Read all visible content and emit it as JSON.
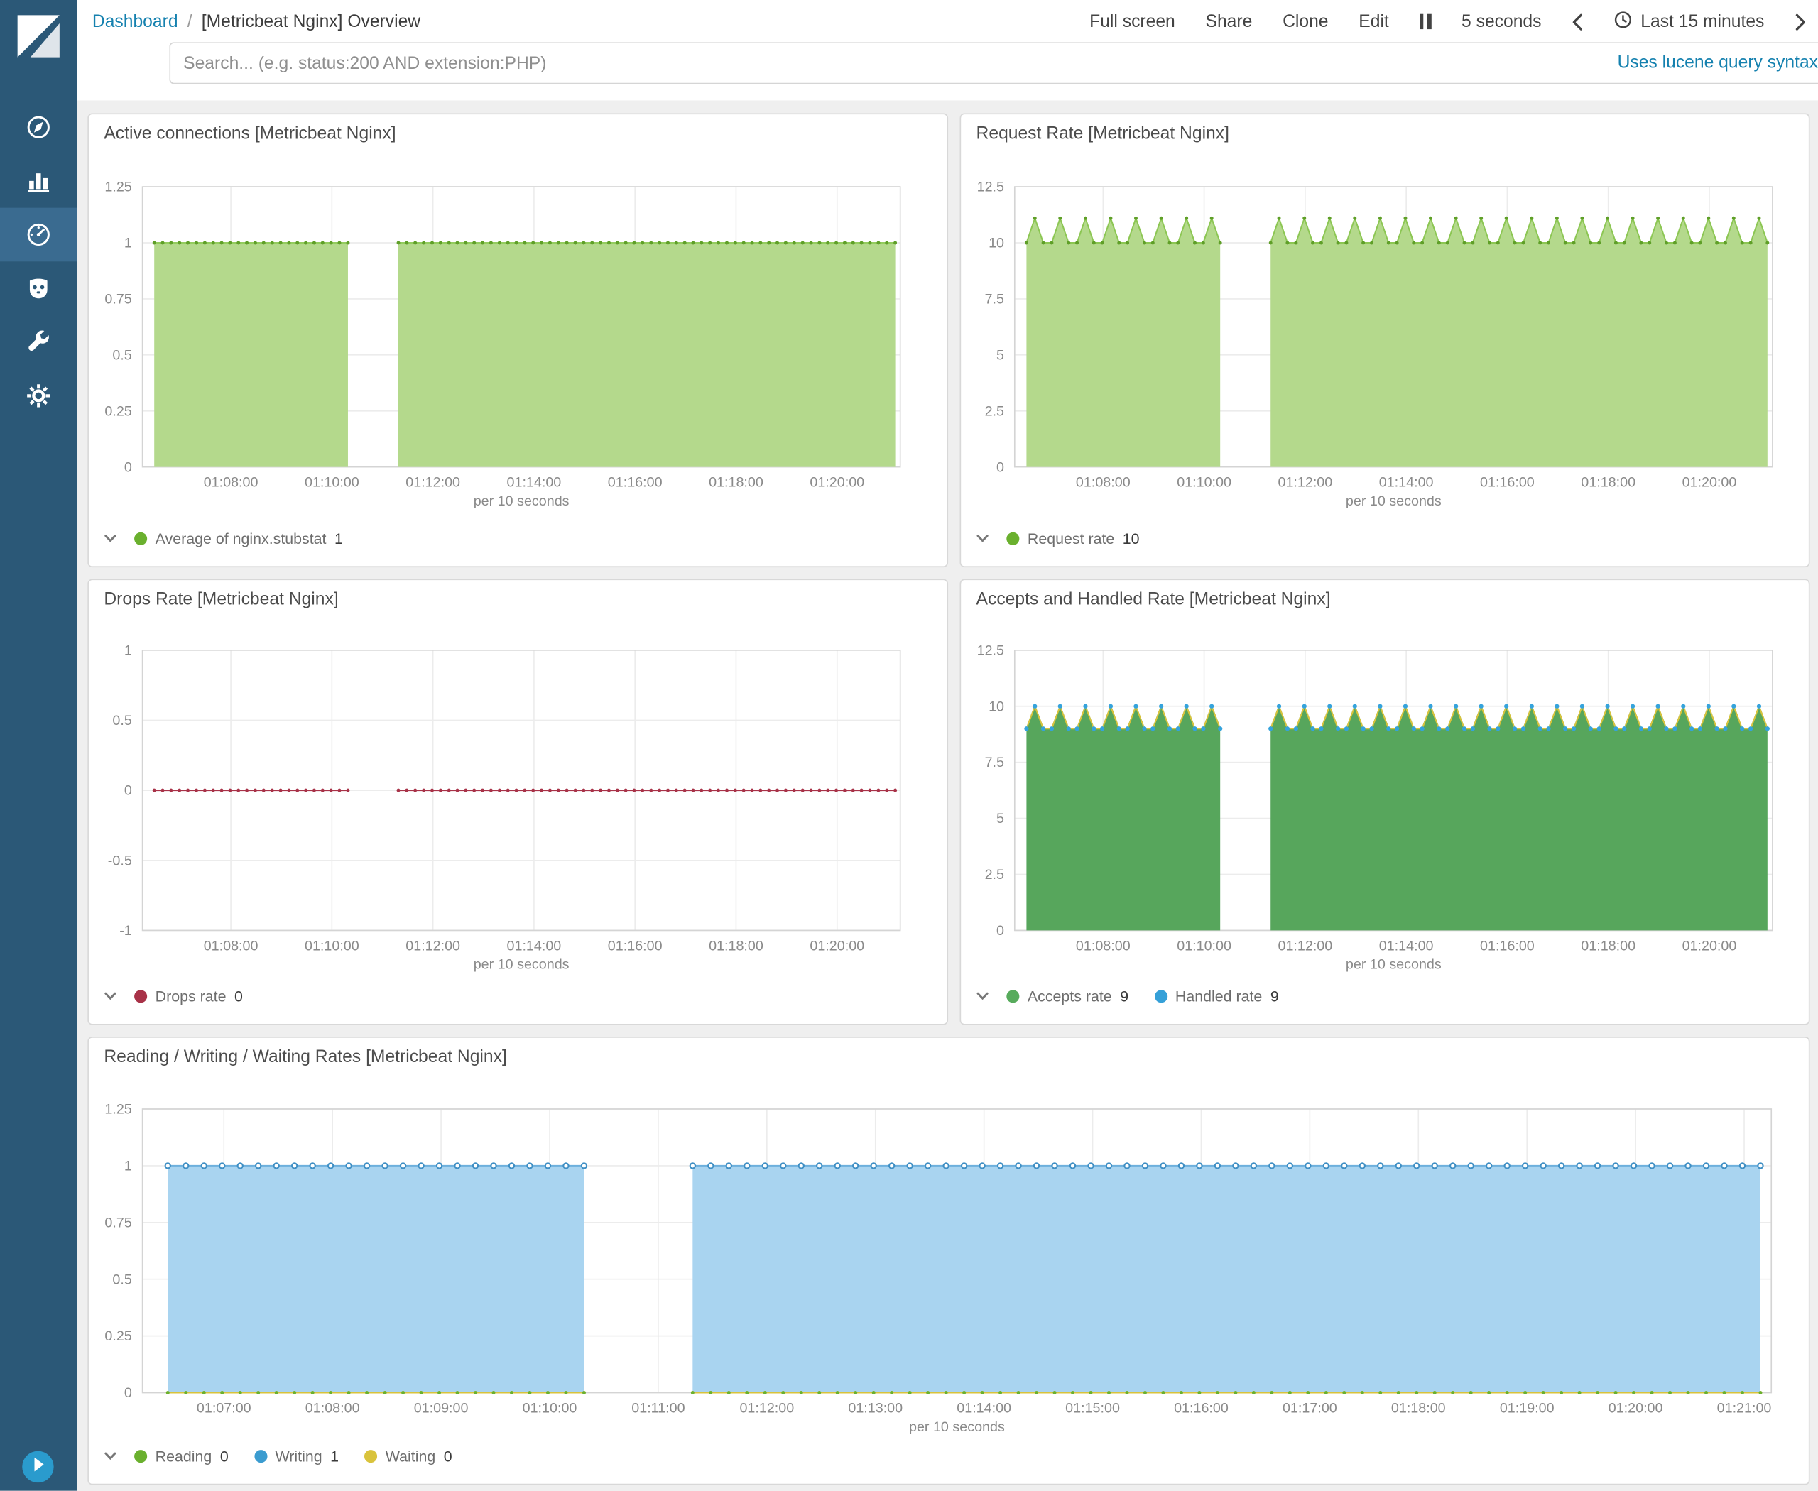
{
  "app": {
    "breadcrumb": {
      "root": "Dashboard",
      "separator": "/",
      "current": "[Metricbeat Nginx] Overview"
    },
    "actions": {
      "full_screen": "Full screen",
      "share": "Share",
      "clone": "Clone",
      "edit": "Edit",
      "refresh_interval": "5 seconds",
      "time_range": "Last 15 minutes"
    }
  },
  "search": {
    "placeholder": "Search... (e.g. status:200 AND extension:PHP)",
    "syntax_link": "Uses lucene query syntax"
  },
  "sidebar": {
    "items": [
      {
        "name": "discover",
        "icon": "compass-icon",
        "active": false
      },
      {
        "name": "visualize",
        "icon": "bar-chart-icon",
        "active": false
      },
      {
        "name": "dashboard",
        "icon": "gauge-icon",
        "active": true
      },
      {
        "name": "timelion",
        "icon": "timelion-icon",
        "active": false
      },
      {
        "name": "dev-tools",
        "icon": "wrench-icon",
        "active": false
      },
      {
        "name": "management",
        "icon": "gear-icon",
        "active": false
      }
    ]
  },
  "colors": {
    "sidebar_bg": "#2b5877",
    "sidebar_active_bg": "#3a6b90",
    "link": "#1581af",
    "search_button_bg": "#58595b",
    "collapse_button_bg": "#2a9bcd",
    "panel_border": "#d8d8d8",
    "content_bg": "#efefef"
  },
  "chart_data": [
    {
      "id": "active-connections",
      "type": "area",
      "title": "Active connections [Metricbeat Nginx]",
      "ylim": [
        0,
        1.25
      ],
      "yticks": [
        0,
        0.25,
        0.5,
        0.75,
        1,
        1.25
      ],
      "x_domain": [
        "01:06:15",
        "01:21:15"
      ],
      "x_span_s": 900,
      "sample_interval_s": 10,
      "segments_s": [
        [
          14,
          245
        ],
        [
          304,
          898
        ]
      ],
      "xticks": [
        {
          "t": 105,
          "label": "01:08:00"
        },
        {
          "t": 225,
          "label": "01:10:00"
        },
        {
          "t": 345,
          "label": "01:12:00"
        },
        {
          "t": 465,
          "label": "01:14:00"
        },
        {
          "t": 585,
          "label": "01:16:00"
        },
        {
          "t": 705,
          "label": "01:18:00"
        },
        {
          "t": 825,
          "label": "01:20:00"
        }
      ],
      "xlabel": "per 10 seconds",
      "series": [
        {
          "name": "Average of nginx.stubstat",
          "type": "area",
          "pattern": "constant",
          "base": 1,
          "fill": "#b4d98c",
          "stroke": "#94cc5f",
          "dot": "#5f9f28",
          "dot_style": "filled"
        }
      ],
      "legend": [
        {
          "label": "Average of nginx.stubstat",
          "value": "1",
          "color": "#6ab02e"
        }
      ]
    },
    {
      "id": "request-rate",
      "type": "area",
      "title": "Request Rate [Metricbeat Nginx]",
      "ylim": [
        0,
        12.5
      ],
      "yticks": [
        0,
        2.5,
        5,
        7.5,
        10,
        12.5
      ],
      "x_domain": [
        "01:06:15",
        "01:21:15"
      ],
      "x_span_s": 900,
      "sample_interval_s": 10,
      "segments_s": [
        [
          14,
          245
        ],
        [
          304,
          898
        ]
      ],
      "xticks": [
        {
          "t": 105,
          "label": "01:08:00"
        },
        {
          "t": 225,
          "label": "01:10:00"
        },
        {
          "t": 345,
          "label": "01:12:00"
        },
        {
          "t": 465,
          "label": "01:14:00"
        },
        {
          "t": 585,
          "label": "01:16:00"
        },
        {
          "t": 705,
          "label": "01:18:00"
        },
        {
          "t": 825,
          "label": "01:20:00"
        }
      ],
      "xlabel": "per 10 seconds",
      "series": [
        {
          "name": "Request rate",
          "type": "area",
          "pattern": "teeth",
          "base": 10,
          "peak": 11.1,
          "period": 3,
          "fill": "#b4d98c",
          "stroke": "#8cc653",
          "dot": "#5f9f28",
          "dot_style": "filled"
        }
      ],
      "legend": [
        {
          "label": "Request rate",
          "value": "10",
          "color": "#6ab02e"
        }
      ]
    },
    {
      "id": "drops-rate",
      "type": "line",
      "title": "Drops Rate [Metricbeat Nginx]",
      "ylim": [
        -1,
        1
      ],
      "yticks": [
        -1,
        -0.5,
        0,
        0.5,
        1
      ],
      "x_domain": [
        "01:06:15",
        "01:21:15"
      ],
      "x_span_s": 900,
      "sample_interval_s": 10,
      "segments_s": [
        [
          14,
          245
        ],
        [
          304,
          898
        ]
      ],
      "xticks": [
        {
          "t": 105,
          "label": "01:08:00"
        },
        {
          "t": 225,
          "label": "01:10:00"
        },
        {
          "t": 345,
          "label": "01:12:00"
        },
        {
          "t": 465,
          "label": "01:14:00"
        },
        {
          "t": 585,
          "label": "01:16:00"
        },
        {
          "t": 705,
          "label": "01:18:00"
        },
        {
          "t": 825,
          "label": "01:20:00"
        }
      ],
      "xlabel": "per 10 seconds",
      "series": [
        {
          "name": "Drops rate",
          "type": "line",
          "pattern": "constant",
          "base": 0,
          "stroke": "#a83248",
          "dot": "#a83248",
          "dot_style": "filled"
        }
      ],
      "legend": [
        {
          "label": "Drops rate",
          "value": "0",
          "color": "#a83248"
        }
      ]
    },
    {
      "id": "accepts-handled",
      "type": "area",
      "title": "Accepts and Handled Rate [Metricbeat Nginx]",
      "ylim": [
        0,
        12.5
      ],
      "yticks": [
        0,
        2.5,
        5,
        7.5,
        10,
        12.5
      ],
      "x_domain": [
        "01:06:15",
        "01:21:15"
      ],
      "x_span_s": 900,
      "sample_interval_s": 10,
      "segments_s": [
        [
          14,
          245
        ],
        [
          304,
          898
        ]
      ],
      "xticks": [
        {
          "t": 105,
          "label": "01:08:00"
        },
        {
          "t": 225,
          "label": "01:10:00"
        },
        {
          "t": 345,
          "label": "01:12:00"
        },
        {
          "t": 465,
          "label": "01:14:00"
        },
        {
          "t": 585,
          "label": "01:16:00"
        },
        {
          "t": 705,
          "label": "01:18:00"
        },
        {
          "t": 825,
          "label": "01:20:00"
        }
      ],
      "xlabel": "per 10 seconds",
      "series": [
        {
          "name": "Accepts rate",
          "type": "area",
          "pattern": "teeth",
          "base": 9,
          "peak": 10,
          "period": 3,
          "fill": "#57a65c",
          "stroke": "#4a9a50",
          "dot": null,
          "dot_style": "none"
        },
        {
          "name": "Handled rate",
          "type": "line",
          "pattern": "teeth",
          "base": 9,
          "peak": 10,
          "period": 3,
          "stroke": "#d9c33c",
          "dot": "#35a3dc",
          "dot_style": "filled-lg"
        }
      ],
      "legend": [
        {
          "label": "Accepts rate",
          "value": "9",
          "color": "#57ab5c"
        },
        {
          "label": "Handled rate",
          "value": "9",
          "color": "#35a0d8"
        }
      ]
    },
    {
      "id": "reading-writing-waiting",
      "type": "area",
      "title": "Reading / Writing / Waiting Rates [Metricbeat Nginx]",
      "ylim": [
        0,
        1.25
      ],
      "yticks": [
        0,
        0.25,
        0.5,
        0.75,
        1,
        1.25
      ],
      "x_domain": [
        "01:06:15",
        "01:21:15"
      ],
      "x_span_s": 900,
      "sample_interval_s": 10,
      "segments_s": [
        [
          14,
          245
        ],
        [
          304,
          898
        ]
      ],
      "xticks": [
        {
          "t": 45,
          "label": "01:07:00"
        },
        {
          "t": 105,
          "label": "01:08:00"
        },
        {
          "t": 165,
          "label": "01:09:00"
        },
        {
          "t": 225,
          "label": "01:10:00"
        },
        {
          "t": 285,
          "label": "01:11:00"
        },
        {
          "t": 345,
          "label": "01:12:00"
        },
        {
          "t": 405,
          "label": "01:13:00"
        },
        {
          "t": 465,
          "label": "01:14:00"
        },
        {
          "t": 525,
          "label": "01:15:00"
        },
        {
          "t": 585,
          "label": "01:16:00"
        },
        {
          "t": 645,
          "label": "01:17:00"
        },
        {
          "t": 705,
          "label": "01:18:00"
        },
        {
          "t": 765,
          "label": "01:19:00"
        },
        {
          "t": 825,
          "label": "01:20:00"
        },
        {
          "t": 885,
          "label": "01:21:00"
        }
      ],
      "xlabel": "per 10 seconds",
      "series": [
        {
          "name": "Writing",
          "type": "area",
          "pattern": "constant",
          "base": 1,
          "fill": "#a9d4f0",
          "stroke": "#6db0dd",
          "dot": "#3f8fc4",
          "dot_style": "ring"
        },
        {
          "name": "Waiting",
          "type": "line",
          "pattern": "constant",
          "base": 0,
          "stroke": "#d9c33c",
          "dot": "#d9c33c",
          "dot_style": "filled"
        },
        {
          "name": "Reading",
          "type": "line",
          "pattern": "constant",
          "base": 0,
          "stroke": null,
          "dot": "#6ab02e",
          "dot_style": "filled"
        }
      ],
      "legend": [
        {
          "label": "Reading",
          "value": "0",
          "color": "#6ab02e"
        },
        {
          "label": "Writing",
          "value": "1",
          "color": "#3b9cd0"
        },
        {
          "label": "Waiting",
          "value": "0",
          "color": "#d9c33c"
        }
      ]
    }
  ]
}
